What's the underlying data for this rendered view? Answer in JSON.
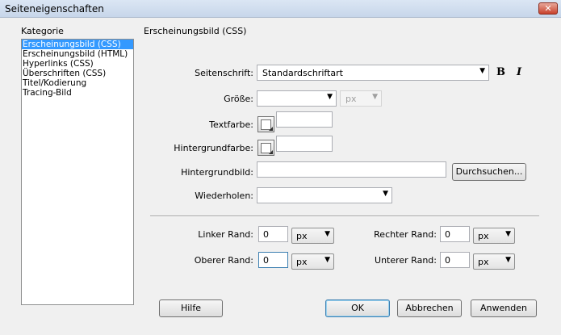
{
  "window": {
    "title": "Seiteneigenschaften",
    "close_glyph": "✕"
  },
  "category": {
    "heading": "Kategorie",
    "items": [
      "Erscheinungsbild (CSS)",
      "Erscheinungsbild (HTML)",
      "Hyperlinks (CSS)",
      "Überschriften (CSS)",
      "Titel/Kodierung",
      "Tracing-Bild"
    ],
    "selected_index": 0
  },
  "panel": {
    "heading": "Erscheinungsbild (CSS)",
    "page_font": {
      "label": "Seitenschrift:",
      "value": "Standardschriftart",
      "bold_label": "B",
      "italic_label": "I"
    },
    "size": {
      "label": "Größe:",
      "value": "",
      "unit": "px"
    },
    "text_color": {
      "label": "Textfarbe:",
      "value": ""
    },
    "bg_color": {
      "label": "Hintergrundfarbe:",
      "value": ""
    },
    "bg_image": {
      "label": "Hintergrundbild:",
      "value": "",
      "browse_label": "Durchsuchen..."
    },
    "repeat": {
      "label": "Wiederholen:",
      "value": ""
    },
    "margins": {
      "left": {
        "label": "Linker Rand:",
        "value": "0",
        "unit": "px"
      },
      "right": {
        "label": "Rechter Rand:",
        "value": "0",
        "unit": "px"
      },
      "top": {
        "label": "Oberer Rand:",
        "value": "0",
        "unit": "px"
      },
      "bottom": {
        "label": "Unterer Rand:",
        "value": "0",
        "unit": "px"
      }
    }
  },
  "buttons": {
    "help": "Hilfe",
    "ok": "OK",
    "cancel": "Abbrechen",
    "apply": "Anwenden"
  },
  "colors": {
    "selection": "#3399ff",
    "dialog_bg": "#f0f0f0",
    "titlebar": "#c7d6ea",
    "close": "#c8412c"
  }
}
